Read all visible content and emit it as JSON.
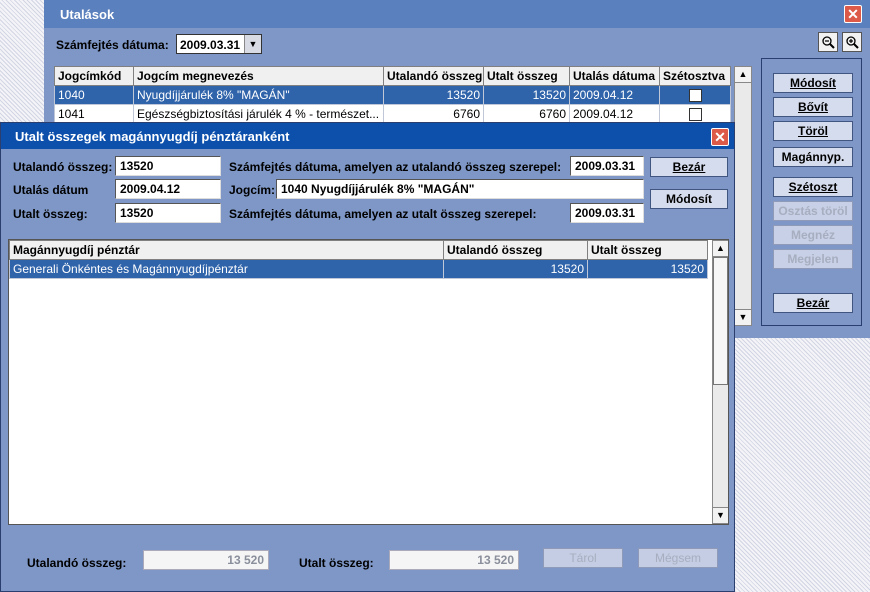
{
  "back_window": {
    "title": "Utalások",
    "close_glyph": "✕",
    "date_label": "Számfejtés dátuma:",
    "date_value": "2009.03.31",
    "zoom_out_icon": "zoom-out-icon",
    "zoom_in_icon": "zoom-in-icon",
    "table": {
      "headers": [
        "Jogcímkód",
        "Jogcím megnevezés",
        "Utalandó összeg",
        "Utalt összeg",
        "Utalás dátuma",
        "Szétosztva"
      ],
      "rows": [
        {
          "code": "1040",
          "name": "Nyugdíjjárulék 8% \"MAGÁN\"",
          "due": "13520",
          "paid": "13520",
          "date": "2009.04.12",
          "distributed": false
        },
        {
          "code": "1041",
          "name": "Egészségbiztosítási járulék 4 % - természet...",
          "due": "6760",
          "paid": "6760",
          "date": "2009.04.12",
          "distributed": false
        }
      ]
    },
    "side_buttons": {
      "modosit": "Módosít",
      "bovit": "Bővít",
      "torol": "Töröl",
      "magannyp": "Magánnyp.",
      "szetoszt": "Szétoszt",
      "osztas_torol": "Osztás töröl",
      "megnez": "Megnéz",
      "megjelen": "Megjelen",
      "bezar": "Bezár"
    }
  },
  "dialog": {
    "title": "Utalt összegek magánnyugdíj pénztáranként",
    "close_glyph": "✕",
    "labels": {
      "utalando": "Utalandó összeg:",
      "utalas_datum": "Utalás dátum",
      "utalt": "Utalt összeg:",
      "szamf_utalando": "Számfejtés dátuma, amelyen az utalandó összeg szerepel:",
      "jogcim": "Jogcím:",
      "szamf_utalt": "Számfejtés dátuma, amelyen az utalt összeg szerepel:"
    },
    "values": {
      "utalando": "13520",
      "utalas_datum": "2009.04.12",
      "utalt": "13520",
      "szamf_utalando": "2009.03.31",
      "jogcim": "1040 Nyugdíjjárulék 8% \"MAGÁN\"",
      "szamf_utalt": "2009.03.31"
    },
    "buttons": {
      "bezar": "Bezár",
      "modosit": "Módosít",
      "tarol": "Tárol",
      "megsem": "Mégsem"
    },
    "list": {
      "headers": [
        "Magánnyugdíj pénztár",
        "Utalandó összeg",
        "Utalt összeg"
      ],
      "rows": [
        {
          "fund": "Generali Önkéntes és Magánnyugdíjpénztár",
          "due": "13520",
          "paid": "13520"
        }
      ]
    },
    "footer": {
      "utalando_label": "Utalandó összeg:",
      "utalando_value": "13 520",
      "utalt_label": "Utalt összeg:",
      "utalt_value": "13 520"
    }
  }
}
